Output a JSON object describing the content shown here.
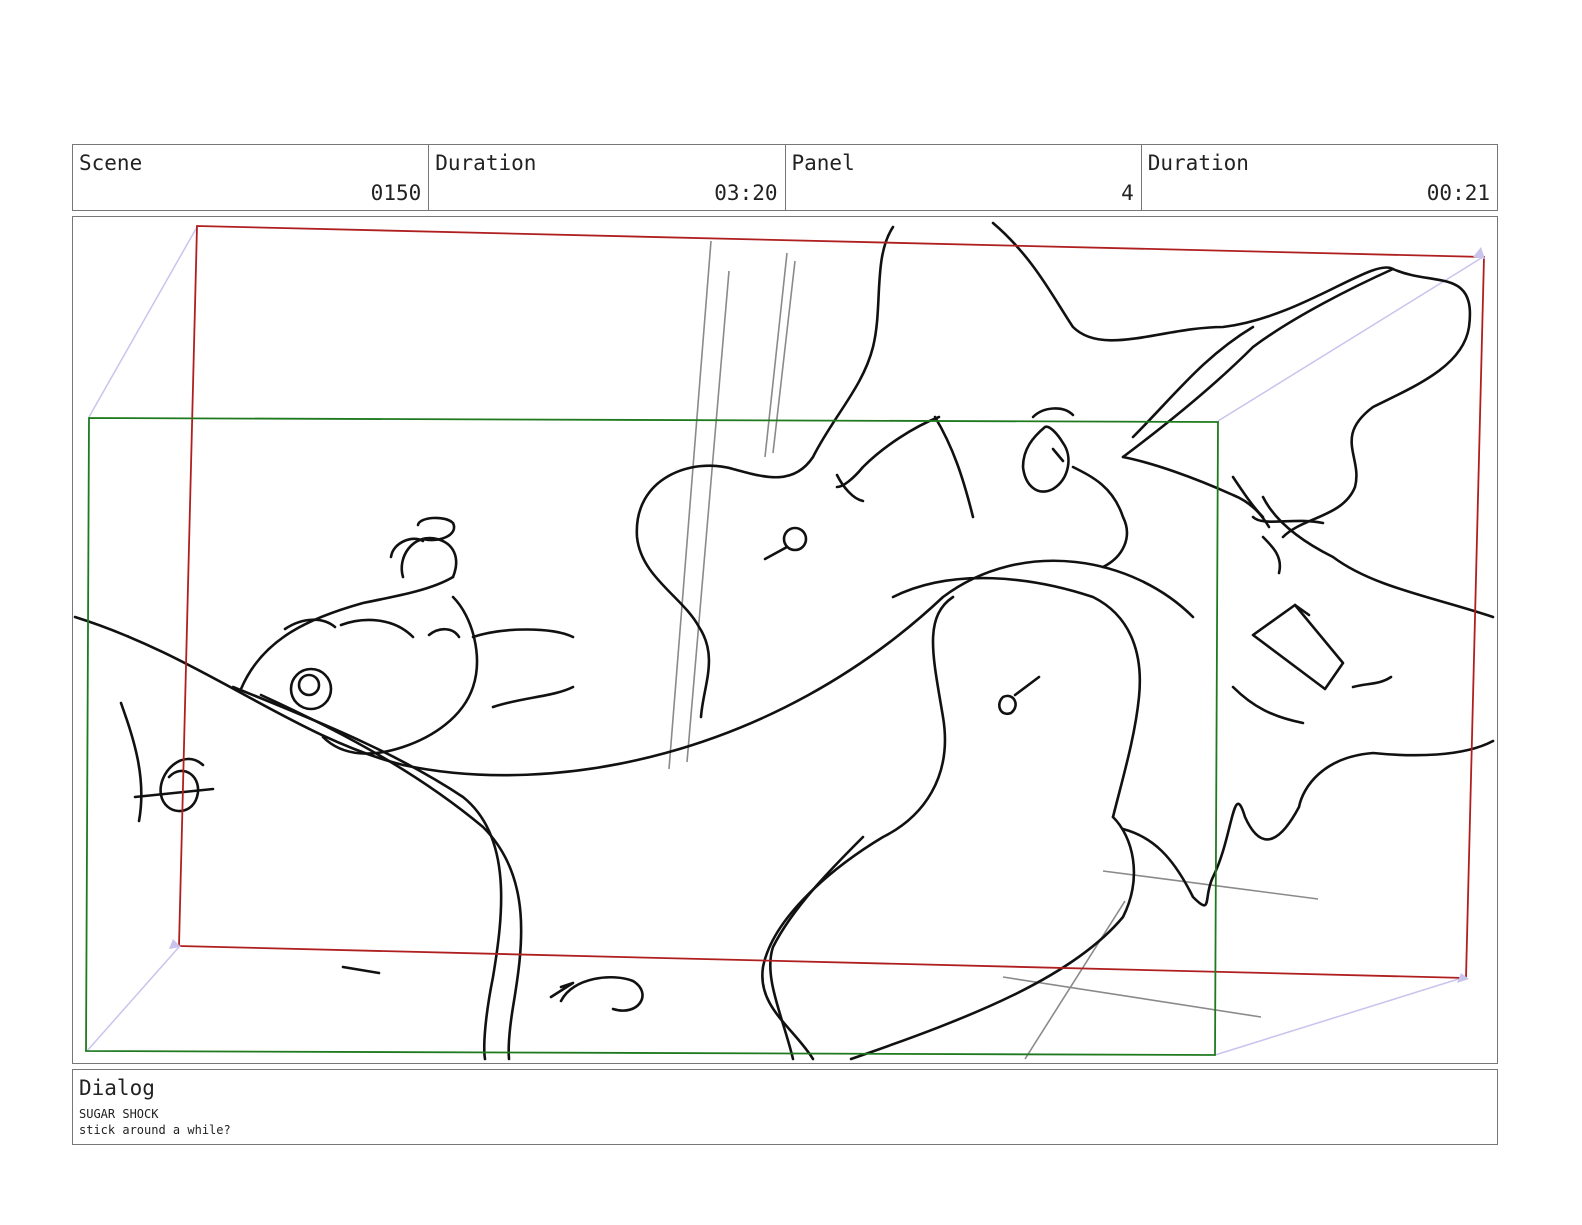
{
  "header": {
    "scene": {
      "label": "Scene",
      "value": "0150"
    },
    "scene_duration": {
      "label": "Duration",
      "value": "03:20"
    },
    "panel": {
      "label": "Panel",
      "value": "4"
    },
    "panel_duration": {
      "label": "Duration",
      "value": "00:21"
    }
  },
  "dialog": {
    "label": "Dialog",
    "speaker": "SUGAR SHOCK",
    "text": "stick around a while?"
  },
  "colors": {
    "border": "#777777",
    "camera_frame_start": "#b01f1f",
    "camera_frame_end": "#1f7a1f",
    "camera_move_guides": "#c8c4ee",
    "sketch": "#111111",
    "background_lines": "#8a8a8a"
  }
}
